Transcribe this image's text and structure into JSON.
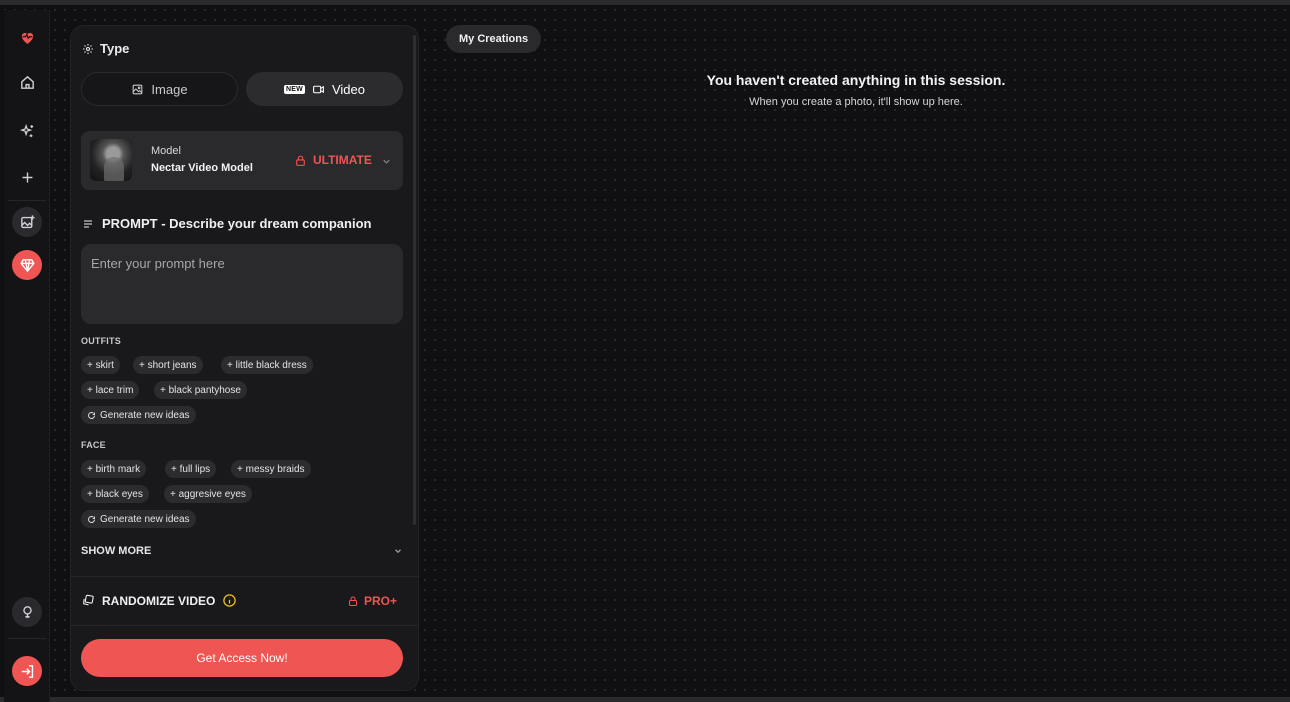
{
  "colors": {
    "accent": "#ef5552",
    "panel": "#19191b",
    "card": "#2a2a2d",
    "background": "#101012"
  },
  "rail": {
    "items": [
      {
        "icon": "heart-pulse-icon"
      },
      {
        "icon": "home-icon"
      },
      {
        "icon": "sparkles-icon"
      },
      {
        "icon": "plus-icon"
      },
      {
        "icon": "image-add-icon"
      },
      {
        "icon": "diamond-icon"
      },
      {
        "icon": "lightbulb-icon"
      },
      {
        "icon": "login-icon"
      }
    ]
  },
  "panel": {
    "type_label": "Type",
    "type_options": [
      {
        "label": "Image",
        "icon": "image-icon",
        "selected": false
      },
      {
        "label": "Video",
        "icon": "video-icon",
        "badge": "NEW",
        "selected": true
      }
    ],
    "model": {
      "sub_label": "Model",
      "name": "Nectar Video Model",
      "tier": "ULTIMATE"
    },
    "prompt": {
      "title": "PROMPT - Describe your dream companion",
      "placeholder": "Enter your prompt here",
      "value": ""
    },
    "outfits": {
      "label": "OUTFITS",
      "chips": [
        "+ skirt",
        "+ short jeans",
        "+ little black dress",
        "+ lace trim",
        "+ black pantyhose"
      ],
      "generate_label": "Generate new ideas"
    },
    "face": {
      "label": "FACE",
      "chips": [
        "+ birth mark",
        "+ full lips",
        "+ messy braids",
        "+ black eyes",
        "+ aggresive eyes"
      ],
      "generate_label": "Generate new ideas"
    },
    "show_more": "SHOW MORE",
    "randomize": {
      "label": "RANDOMIZE VIDEO",
      "tier": "PRO+"
    },
    "cta_label": "Get Access Now!"
  },
  "main": {
    "my_creations_label": "My Creations",
    "empty_title": "You haven't created anything in this session.",
    "empty_subtitle": "When you create a photo, it'll show up here."
  }
}
